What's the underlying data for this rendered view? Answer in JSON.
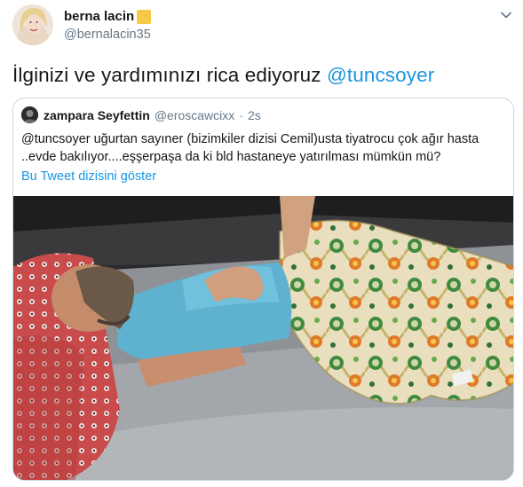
{
  "author": {
    "display_name": "berna lacin",
    "handle": "@bernalacin35",
    "avatar_icon": "profile-photo-icon"
  },
  "tweet": {
    "text_before": "İlginizi ve yardımınızı rica ediyoruz",
    "mention": "@tuncsoyer"
  },
  "quoted_tweet": {
    "display_name": "zampara Seyfettin",
    "handle": "@eroscawcixx",
    "separator": "·",
    "time": "2s",
    "text_line1": "@tuncsoyer uğurtan sayıner (bizimkiler dizisi Cemil)usta tiyatrocu çok ağır hasta",
    "text_line2": "..evde bakılıyor....eşşerpaşa da ki bld hastaneye yatırılması mümkün mü?",
    "show_thread_label": "Bu Tweet dizisini göster"
  },
  "colors": {
    "link": "#1b95e0",
    "text": "#14171a",
    "secondary": "#657786",
    "border": "#ccd6dd"
  }
}
